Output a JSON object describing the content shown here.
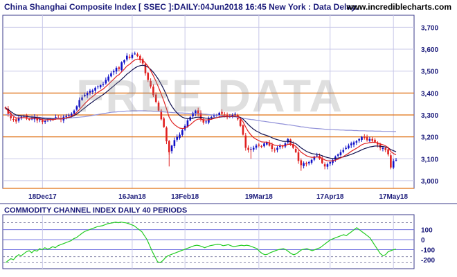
{
  "header": {
    "title": "China Shanghai Composite Index [ SSEC ]:DAILY:04Jun2018 16:45 New York : Data Delay..",
    "site": "www.incrediblecharts.com"
  },
  "watermark": "FREE DATA",
  "colors": {
    "up": "#1010c8",
    "down": "#e02020",
    "ema_fast": "#e02020",
    "ema_slow": "#101050",
    "ma_long": "#9090d8",
    "level_line": "#e07010",
    "cci": "#22cc22",
    "ref_line": "#7070e0",
    "grid": "#c8c8e8"
  },
  "chart_data": [
    {
      "type": "candlestick",
      "title": "China Shanghai Composite Index [ SSEC ]:DAILY:04Jun2018 16:45 New York : Data Delay..",
      "x_tick_labels": [
        "18Dec17",
        "16Jan18",
        "13Feb18",
        "19Mar18",
        "17Apr18",
        "17May18"
      ],
      "y_tick_labels": [
        "3,000",
        "3,100",
        "3,200",
        "3,300",
        "3,400",
        "3,500",
        "3,600",
        "3,700"
      ],
      "ylim": [
        2965,
        3755
      ],
      "horizontal_levels": [
        2965,
        3200,
        3300,
        3400
      ],
      "grid": true,
      "series": [
        {
          "kind": "close",
          "values": [
            3330,
            3305,
            3285,
            3280,
            3270,
            3288,
            3292,
            3295,
            3283,
            3278,
            3285,
            3292,
            3275,
            3280,
            3268,
            3272,
            3280,
            3282,
            3278,
            3290,
            3285,
            3280,
            3292,
            3296,
            3300,
            3306,
            3320,
            3340,
            3368,
            3380,
            3392,
            3400,
            3410,
            3412,
            3424,
            3430,
            3436,
            3440,
            3460,
            3475,
            3490,
            3500,
            3515,
            3510,
            3540,
            3550,
            3570,
            3560,
            3575,
            3580,
            3568,
            3550,
            3535,
            3490,
            3460,
            3430,
            3390,
            3360,
            3320,
            3280,
            3245,
            3180,
            3130,
            3160,
            3185,
            3200,
            3210,
            3230,
            3250,
            3275,
            3290,
            3310,
            3320,
            3305,
            3280,
            3265,
            3270,
            3285,
            3290,
            3300,
            3300,
            3310,
            3305,
            3300,
            3290,
            3295,
            3300,
            3305,
            3280,
            3250,
            3210,
            3150,
            3140,
            3145,
            3150,
            3160,
            3160,
            3155,
            3170,
            3175,
            3160,
            3145,
            3140,
            3150,
            3160,
            3155,
            3170,
            3190,
            3165,
            3150,
            3130,
            3090,
            3071,
            3080,
            3075,
            3085,
            3095,
            3110,
            3115,
            3100,
            3080,
            3065,
            3075,
            3085,
            3095,
            3110,
            3120,
            3130,
            3140,
            3150,
            3160,
            3170,
            3175,
            3180,
            3190,
            3200,
            3195,
            3185,
            3190,
            3182,
            3175,
            3165,
            3150,
            3150,
            3140,
            3120,
            3060,
            3090,
            3095
          ]
        },
        {
          "kind": "ema_fast",
          "values": [
            3330,
            3318,
            3304,
            3294,
            3286,
            3286,
            3287,
            3288,
            3286,
            3284,
            3284,
            3286,
            3283,
            3282,
            3278,
            3277,
            3278,
            3279,
            3278,
            3281,
            3282,
            3281,
            3284,
            3287,
            3290,
            3294,
            3301,
            3311,
            3325,
            3338,
            3351,
            3363,
            3375,
            3384,
            3394,
            3403,
            3411,
            3418,
            3429,
            3440,
            3452,
            3463,
            3476,
            3484,
            3497,
            3509,
            3523,
            3531,
            3542,
            3551,
            3555,
            3554,
            3550,
            3537,
            3522,
            3502,
            3479,
            3454,
            3426,
            3395,
            3364,
            3328,
            3290,
            3269,
            3256,
            3247,
            3240,
            3238,
            3240,
            3247,
            3255,
            3266,
            3276,
            3281,
            3281,
            3278,
            3277,
            3278,
            3280,
            3284,
            3287,
            3291,
            3293,
            3294,
            3293,
            3293,
            3294,
            3296,
            3293,
            3284,
            3269,
            3245,
            3224,
            3209,
            3197,
            3189,
            3183,
            3177,
            3176,
            3176,
            3173,
            3167,
            3162,
            3160,
            3160,
            3159,
            3161,
            3166,
            3166,
            3163,
            3157,
            3144,
            3130,
            3122,
            3114,
            3109,
            3107,
            3107,
            3108,
            3107,
            3102,
            3095,
            3091,
            3090,
            3090,
            3094,
            3098,
            3104,
            3110,
            3118,
            3125,
            3134,
            3141,
            3148,
            3156,
            3164,
            3169,
            3171,
            3174,
            3175,
            3175,
            3173,
            3168,
            3164,
            3159,
            3151,
            3133,
            3124,
            3118
          ]
        },
        {
          "kind": "ema_slow",
          "values": [
            3332,
            3325,
            3315,
            3307,
            3300,
            3298,
            3296,
            3295,
            3293,
            3291,
            3290,
            3290,
            3288,
            3287,
            3284,
            3282,
            3282,
            3282,
            3281,
            3282,
            3282,
            3282,
            3284,
            3286,
            3289,
            3292,
            3297,
            3304,
            3313,
            3323,
            3332,
            3342,
            3351,
            3360,
            3369,
            3377,
            3385,
            3393,
            3402,
            3412,
            3422,
            3432,
            3443,
            3452,
            3463,
            3474,
            3486,
            3495,
            3505,
            3514,
            3521,
            3525,
            3527,
            3524,
            3518,
            3508,
            3495,
            3479,
            3461,
            3440,
            3417,
            3390,
            3361,
            3340,
            3323,
            3309,
            3298,
            3290,
            3285,
            3283,
            3283,
            3285,
            3289,
            3290,
            3289,
            3287,
            3285,
            3285,
            3285,
            3286,
            3288,
            3290,
            3291,
            3292,
            3292,
            3292,
            3293,
            3294,
            3293,
            3289,
            3281,
            3269,
            3256,
            3245,
            3235,
            3227,
            3221,
            3214,
            3210,
            3206,
            3202,
            3196,
            3191,
            3187,
            3184,
            3180,
            3179,
            3180,
            3178,
            3174,
            3169,
            3160,
            3150,
            3142,
            3134,
            3129,
            3124,
            3122,
            3120,
            3118,
            3114,
            3109,
            3106,
            3103,
            3101,
            3102,
            3103,
            3106,
            3108,
            3112,
            3116,
            3120,
            3125,
            3130,
            3135,
            3141,
            3146,
            3150,
            3154,
            3156,
            3158,
            3158,
            3157,
            3156,
            3154,
            3150,
            3142,
            3137,
            3132
          ]
        },
        {
          "kind": "ma_long",
          "values": [
            3302,
            3301,
            3300,
            3299,
            3298,
            3297,
            3296,
            3295,
            3294,
            3293,
            3292,
            3291,
            3290,
            3289,
            3288,
            3287,
            3286,
            3286,
            3285,
            3285,
            3285,
            3285,
            3285,
            3286,
            3286,
            3287,
            3288,
            3289,
            3290,
            3291,
            3292,
            3294,
            3296,
            3298,
            3300,
            3302,
            3304,
            3306,
            3308,
            3310,
            3312,
            3313,
            3314,
            3315,
            3316,
            3317,
            3318,
            3318,
            3319,
            3319,
            3319,
            3319,
            3319,
            3319,
            3318,
            3318,
            3317,
            3317,
            3316,
            3315,
            3314,
            3313,
            3312,
            3311,
            3310,
            3310,
            3309,
            3309,
            3308,
            3308,
            3307,
            3306,
            3306,
            3305,
            3305,
            3304,
            3303,
            3302,
            3301,
            3300,
            3299,
            3298,
            3297,
            3296,
            3294,
            3293,
            3292,
            3291,
            3289,
            3287,
            3285,
            3283,
            3281,
            3279,
            3278,
            3276,
            3274,
            3272,
            3271,
            3269,
            3267,
            3266,
            3264,
            3262,
            3260,
            3259,
            3257,
            3255,
            3254,
            3252,
            3250,
            3248,
            3246,
            3245,
            3243,
            3241,
            3240,
            3239,
            3238,
            3237,
            3236,
            3235,
            3234,
            3233,
            3233,
            3232,
            3232,
            3231,
            3231,
            3230,
            3230,
            3230,
            3229,
            3229,
            3228,
            3228,
            3228,
            3227,
            3227,
            3227,
            3226,
            3226,
            3226,
            3225,
            3225,
            3225,
            3225,
            3224,
            3224
          ]
        }
      ]
    },
    {
      "type": "line",
      "title": "COMMODITY CHANNEL INDEX DAILY 40 PERIODS",
      "y_tick_labels": [
        "100",
        "0",
        "-100",
        "-200"
      ],
      "ylim": [
        -290,
        250
      ],
      "reference_lines": [
        170,
        100,
        0,
        -100,
        -170,
        -230
      ],
      "series": [
        {
          "values": [
            -230,
            -210,
            -190,
            -200,
            -170,
            -150,
            -160,
            -140,
            -120,
            -110,
            -130,
            -105,
            -115,
            -90,
            -100,
            -80,
            -95,
            -85,
            -70,
            -80,
            -60,
            -50,
            -40,
            -30,
            -20,
            -10,
            10,
            20,
            40,
            60,
            80,
            90,
            100,
            110,
            120,
            130,
            135,
            140,
            150,
            160,
            165,
            170,
            175,
            170,
            176,
            172,
            168,
            160,
            150,
            140,
            120,
            100,
            80,
            40,
            0,
            -60,
            -120,
            -170,
            -220,
            -230,
            -210,
            -180,
            -160,
            -150,
            -140,
            -130,
            -120,
            -110,
            -100,
            -90,
            -80,
            -70,
            -60,
            -55,
            -60,
            -70,
            -80,
            -70,
            -60,
            -55,
            -50,
            -45,
            -50,
            -60,
            -55,
            -50,
            -60,
            -70,
            -65,
            -60,
            -55,
            -60,
            -55,
            -60,
            -70,
            -80,
            -90,
            -120,
            -140,
            -150,
            -145,
            -130,
            -120,
            -110,
            -100,
            -95,
            -90,
            -100,
            -120,
            -140,
            -150,
            -140,
            -120,
            -100,
            -95,
            -90,
            -100,
            -110,
            -100,
            -90,
            -80,
            -60,
            -40,
            -20,
            0,
            10,
            20,
            30,
            40,
            50,
            40,
            60,
            80,
            100,
            120,
            100,
            80,
            60,
            40,
            20,
            -20,
            -60,
            -100,
            -140,
            -160,
            -150,
            -120,
            -110,
            -100,
            -95
          ]
        }
      ]
    }
  ]
}
